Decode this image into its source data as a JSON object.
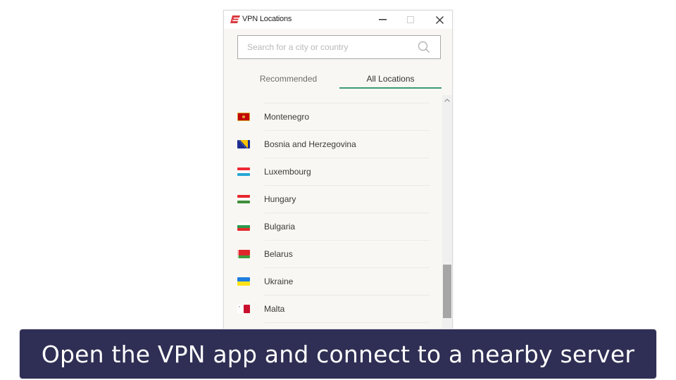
{
  "window": {
    "title": "VPN Locations",
    "logo_icon": "expressvpn-logo-icon",
    "controls": {
      "minimize_icon": "minimize-icon",
      "maximize_icon": "maximize-icon",
      "close_icon": "close-icon"
    }
  },
  "search": {
    "placeholder": "Search for a city or country",
    "value": "",
    "icon": "search-icon"
  },
  "tabs": [
    {
      "label": "Recommended",
      "active": false
    },
    {
      "label": "All Locations",
      "active": true
    }
  ],
  "colors": {
    "accent": "#3c9a73",
    "brand": "#da3940",
    "banner_bg": "#2f2f55"
  },
  "locations": [
    {
      "name": "Montenegro",
      "flag": "montenegro-flag-icon"
    },
    {
      "name": "Bosnia and Herzegovina",
      "flag": "bosnia-flag-icon"
    },
    {
      "name": "Luxembourg",
      "flag": "luxembourg-flag-icon"
    },
    {
      "name": "Hungary",
      "flag": "hungary-flag-icon"
    },
    {
      "name": "Bulgaria",
      "flag": "bulgaria-flag-icon"
    },
    {
      "name": "Belarus",
      "flag": "belarus-flag-icon"
    },
    {
      "name": "Ukraine",
      "flag": "ukraine-flag-icon"
    },
    {
      "name": "Malta",
      "flag": "malta-flag-icon"
    }
  ],
  "scrollbar": {
    "position_fraction": 0.75
  },
  "banner": {
    "text": "Open the VPN app and connect to a nearby server"
  }
}
